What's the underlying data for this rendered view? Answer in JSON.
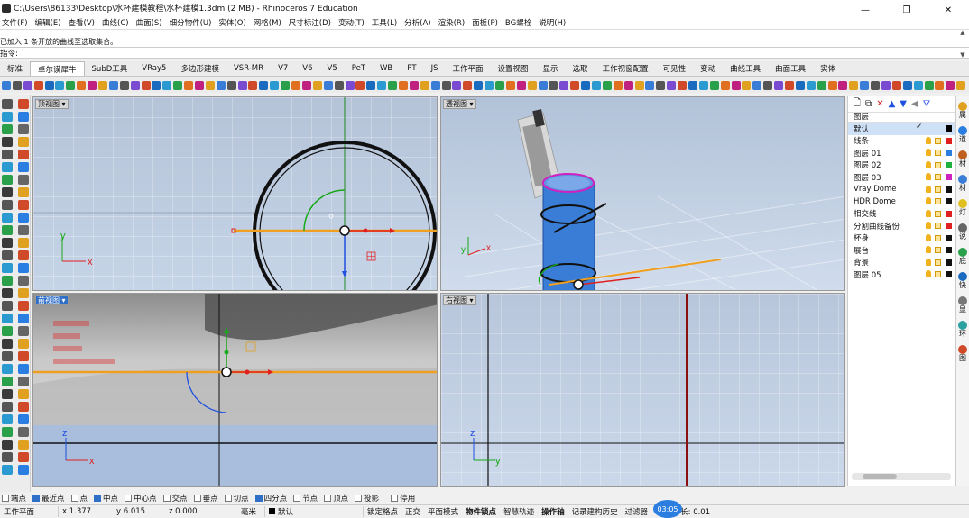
{
  "window": {
    "title": "C:\\Users\\86133\\Desktop\\水杯建模教程\\水杯建模1.3dm (2 MB) - Rhinoceros 7 Education",
    "minimize": "—",
    "maximize": "❐",
    "close": "✕"
  },
  "menu": [
    "文件(F)",
    "编辑(E)",
    "查看(V)",
    "曲线(C)",
    "曲面(S)",
    "细分物件(U)",
    "实体(O)",
    "网格(M)",
    "尺寸标注(D)",
    "变动(T)",
    "工具(L)",
    "分析(A)",
    "渲染(R)",
    "面板(P)",
    "BG螺栓",
    "说明(H)"
  ],
  "command": {
    "history_line": "已加入 1 条开放的曲线至选取集合。",
    "prompt_label": "指令:",
    "value": ""
  },
  "tabs": [
    "标准",
    "卓尔谟犀牛",
    "SubD工具",
    "VRay5",
    "多边形建模",
    "VSR-MR",
    "V7",
    "V6",
    "V5",
    "PeT",
    "WB",
    "PT",
    "JS",
    "工作平面",
    "设置视图",
    "显示",
    "选取",
    "工作视窗配置",
    "可见性",
    "变动",
    "曲线工具",
    "曲面工具",
    "实体"
  ],
  "active_tab_index": 1,
  "viewports": {
    "top": {
      "label": "顶视图 ▾"
    },
    "perspective": {
      "label": "透视图 ▾"
    },
    "front": {
      "label": "前视图 ▾"
    },
    "right": {
      "label": "右视图 ▾"
    }
  },
  "axes": {
    "x": "x",
    "y": "y",
    "z": "z"
  },
  "layers_panel": {
    "header": "图层",
    "layers": [
      {
        "name": "默认",
        "color": "#000000",
        "selected": true,
        "current": "✓"
      },
      {
        "name": "线条",
        "color": "#e02020"
      },
      {
        "name": "图层 01",
        "color": "#2a7de1"
      },
      {
        "name": "图层 02",
        "color": "#20b040"
      },
      {
        "name": "图层 03",
        "color": "#d020c0"
      },
      {
        "name": "Vray Dome",
        "color": "#111111"
      },
      {
        "name": "HDR Dome",
        "color": "#111111"
      },
      {
        "name": "相交线",
        "color": "#e02020"
      },
      {
        "name": "分割曲线备份",
        "color": "#e02020"
      },
      {
        "name": "杯身",
        "color": "#111111"
      },
      {
        "name": "展台",
        "color": "#111111"
      },
      {
        "name": "背景",
        "color": "#111111"
      },
      {
        "name": "图层 05",
        "color": "#111111"
      }
    ]
  },
  "side_tabs": [
    "属",
    "道",
    "材",
    "材",
    "灯",
    "说",
    "底",
    "快",
    "显",
    "环",
    "图"
  ],
  "osnaps": [
    {
      "label": "端点",
      "checked": false
    },
    {
      "label": "最近点",
      "checked": true
    },
    {
      "label": "点",
      "checked": false
    },
    {
      "label": "中点",
      "checked": true
    },
    {
      "label": "中心点",
      "checked": false
    },
    {
      "label": "交点",
      "checked": false
    },
    {
      "label": "垂点",
      "checked": false
    },
    {
      "label": "切点",
      "checked": false
    },
    {
      "label": "四分点",
      "checked": true
    },
    {
      "label": "节点",
      "checked": false
    },
    {
      "label": "顶点",
      "checked": false
    },
    {
      "label": "投影",
      "checked": false
    },
    {
      "label": "停用",
      "checked": false
    }
  ],
  "status": {
    "cplane": "工作平面",
    "x": "x 1.377",
    "y": "y 6.015",
    "z": "z 0.000",
    "unit": "毫米",
    "layer": "默认",
    "grid_snap": "锁定格点",
    "ortho": "正交",
    "planar": "平面模式",
    "osnap": "物件锁点",
    "smarttrack": "智慧轨迹",
    "gumball": "操作轴",
    "history": "记录建构历史",
    "filter": "过滤器",
    "tolerance": "长: 0.01",
    "timer": "03:05"
  },
  "colors": {
    "accent": "#2f6fc8",
    "gumball_x": "#e02020",
    "gumball_y": "#18a818",
    "gumball_z": "#2050e0",
    "selection": "#f0a020"
  }
}
